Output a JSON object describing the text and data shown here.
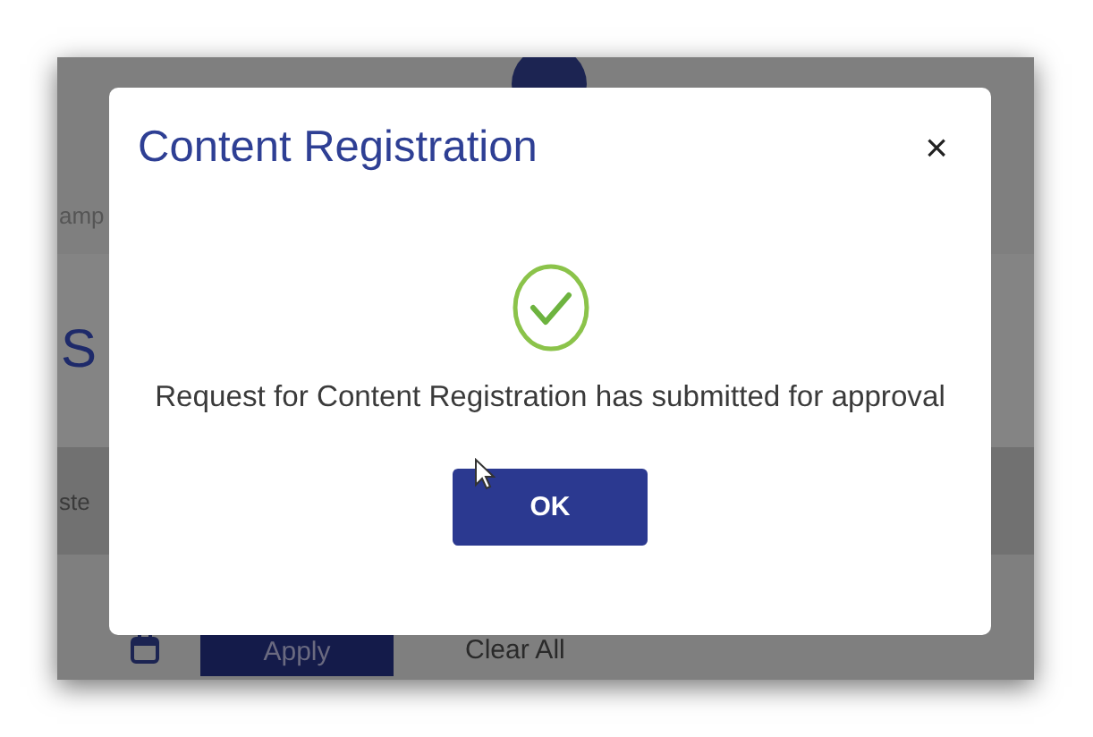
{
  "background_page": {
    "fragment_top": "amp",
    "heading_fragment": "S",
    "fragment_bottom": "ste",
    "apply_button": "Apply",
    "clear_button": "Clear All"
  },
  "dialog": {
    "title": "Content Registration",
    "close": "×",
    "message": "Request for Content Registration has submitted for approval",
    "ok_button": "OK"
  }
}
